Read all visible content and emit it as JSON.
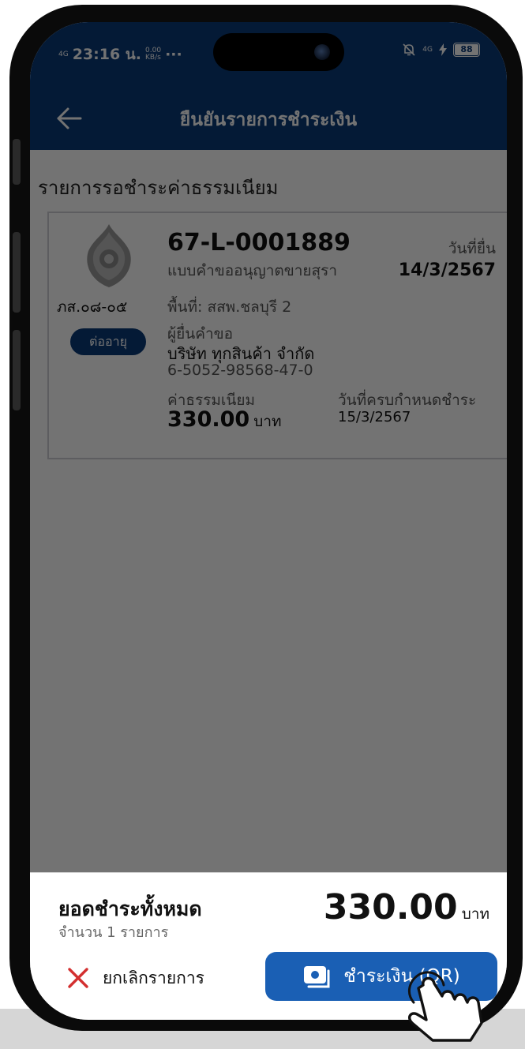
{
  "status_bar": {
    "network": "4G",
    "time": "23:16 น.",
    "speed_value": "0.00",
    "speed_unit": "KB/s",
    "more": "···",
    "right_network": "4G",
    "battery": "88",
    "icons": [
      "bell-off-icon",
      "charging-icon",
      "battery-icon"
    ]
  },
  "header": {
    "title": "ยืนยันรายการชำระเงิน",
    "back_icon": "arrow-left-icon"
  },
  "section_title": "รายการรอชำระค่าธรรมเนียม",
  "card": {
    "emblem": "government-seal-icon",
    "form_code": "ภส.๐๘-๐๕",
    "badge": "ต่ออายุ",
    "reference": "67-L-0001889",
    "form_type": "แบบคำขออนุญาตขายสุรา",
    "submit_date_label": "วันที่ยื่น",
    "submit_date": "14/3/2567",
    "area": "พื้นที่: สสพ.ชลบุรี 2",
    "applicant_label": "ผู้ยื่นคำขอ",
    "applicant_name": "บริษัท ทุกสินค้า จำกัด",
    "applicant_id": "6-5052-98568-47-0",
    "fee_label": "ค่าธรรมเนียม",
    "fee_amount": "330.00",
    "fee_unit": "บาท",
    "due_label": "วันที่ครบกำหนดชำระ",
    "due_date": "15/3/2567"
  },
  "footer": {
    "total_label": "ยอดชำระทั้งหมด",
    "item_count": "จำนวน 1 รายการ",
    "total_amount": "330.00",
    "total_unit": "บาท",
    "cancel_label": "ยกเลิกรายการ",
    "cancel_icon": "close-x-icon",
    "pay_label": "ชำระเงิน (QR)",
    "pay_icon": "wallet-icon"
  },
  "overlay": {
    "pointer_icon": "tap-hand-icon"
  },
  "colors": {
    "header_bg": "#0b3a78",
    "pay_button": "#1a5fb4",
    "cancel_x": "#d32f2f",
    "badge_bg": "#0b3a78"
  }
}
